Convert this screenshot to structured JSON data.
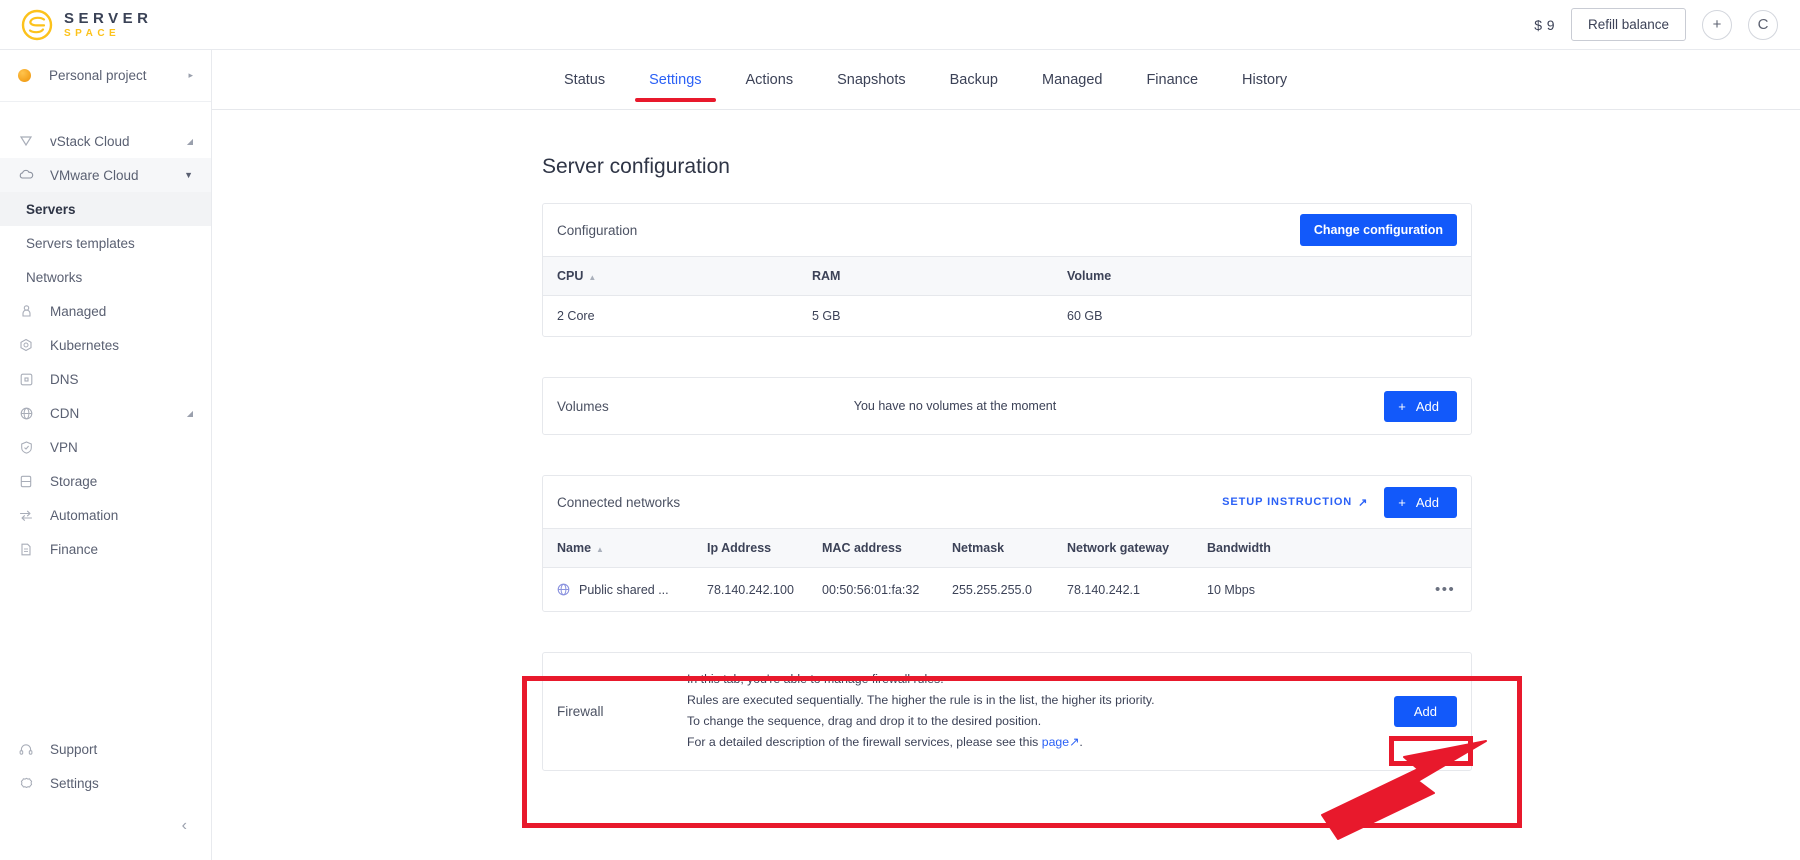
{
  "brand": {
    "name_top": "SERVER",
    "name_bottom": "SPACE",
    "accent": "#fcc21b",
    "dark": "#3a4256"
  },
  "topbar": {
    "balance": "$ 9",
    "refill_label": "Refill balance",
    "add_icon": "+",
    "avatar_label": "C"
  },
  "sidebar": {
    "project": {
      "label": "Personal project",
      "caret": "▸"
    },
    "items": [
      {
        "label": "vStack Cloud",
        "icon": "vstack-icon",
        "caret": "◢",
        "type": "group"
      },
      {
        "label": "VMware Cloud",
        "icon": "cloud-icon",
        "caret": "▼",
        "type": "group-open"
      },
      {
        "label": "Servers",
        "type": "sub",
        "selected": true
      },
      {
        "label": "Servers templates",
        "type": "sub"
      },
      {
        "label": "Networks",
        "type": "sub"
      },
      {
        "label": "Managed",
        "icon": "user-shield-icon"
      },
      {
        "label": "Kubernetes",
        "icon": "kubernetes-icon"
      },
      {
        "label": "DNS",
        "icon": "dns-icon"
      },
      {
        "label": "CDN",
        "icon": "globe-icon",
        "caret": "◢"
      },
      {
        "label": "VPN",
        "icon": "shield-check-icon"
      },
      {
        "label": "Storage",
        "icon": "database-icon"
      },
      {
        "label": "Automation",
        "icon": "automation-icon"
      },
      {
        "label": "Finance",
        "icon": "document-icon"
      }
    ],
    "bottom_items": [
      {
        "label": "Support",
        "icon": "headset-icon"
      },
      {
        "label": "Settings",
        "icon": "gear-icon"
      }
    ],
    "collapse_icon": "‹"
  },
  "tabs": [
    {
      "label": "Status",
      "active": false
    },
    {
      "label": "Settings",
      "active": true
    },
    {
      "label": "Actions",
      "active": false
    },
    {
      "label": "Snapshots",
      "active": false
    },
    {
      "label": "Backup",
      "active": false
    },
    {
      "label": "Managed",
      "active": false
    },
    {
      "label": "Finance",
      "active": false
    },
    {
      "label": "History",
      "active": false
    }
  ],
  "page": {
    "title": "Server configuration"
  },
  "configuration": {
    "header": "Configuration",
    "change_button": "Change configuration",
    "columns": [
      "CPU",
      "RAM",
      "Volume"
    ],
    "sort_column": "CPU",
    "rows": [
      {
        "cpu": "2 Core",
        "ram": "5 GB",
        "volume": "60 GB"
      }
    ]
  },
  "volumes": {
    "header": "Volumes",
    "empty_text": "You have no volumes at the moment",
    "add_button": "Add",
    "add_icon": "+"
  },
  "networks": {
    "header": "Connected networks",
    "setup_link": "Setup instruction",
    "setup_link_icon": "↗",
    "add_button": "Add",
    "add_icon": "+",
    "columns": [
      "Name",
      "Ip Address",
      "MAC address",
      "Netmask",
      "Network gateway",
      "Bandwidth"
    ],
    "sort_column": "Name",
    "rows": [
      {
        "name": "Public shared ...",
        "ip": "78.140.242.100",
        "mac": "00:50:56:01:fa:32",
        "netmask": "255.255.255.0",
        "gateway": "78.140.242.1",
        "bandwidth": "10 Mbps",
        "menu_icon": "•••"
      }
    ]
  },
  "firewall": {
    "header": "Firewall",
    "line1": "In this tab, you're able to manage firewall rules.",
    "line2": "Rules are executed sequentially. The higher the rule is in the list, the higher its priority.",
    "line3": "To change the sequence, drag and drop it to the desired position.",
    "line4_prefix": "For a detailed description of the firewall services, please see this ",
    "line4_link": "page",
    "line4_link_icon": "↗",
    "line4_suffix": ".",
    "add_button": "Add"
  },
  "annotations": {
    "highlight_color": "#e8192c",
    "arrow": "pointer-arrow",
    "region": "firewall-section",
    "target": "firewall-add-button"
  },
  "colors": {
    "primary": "#1259fa",
    "link": "#2b61f6",
    "annotation": "#e8192c"
  }
}
